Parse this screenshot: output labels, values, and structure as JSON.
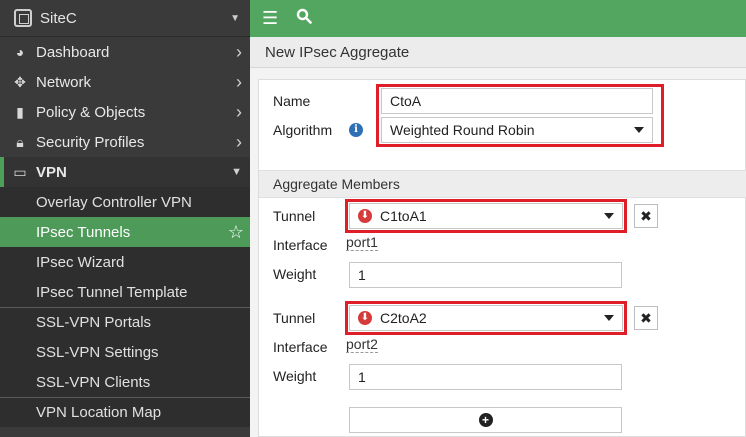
{
  "sidebar": {
    "site_name": "SiteC",
    "items": [
      {
        "label": "Dashboard",
        "icon": "dashboard-icon"
      },
      {
        "label": "Network",
        "icon": "network-icon"
      },
      {
        "label": "Policy & Objects",
        "icon": "policy-icon"
      },
      {
        "label": "Security Profiles",
        "icon": "lock-icon"
      }
    ],
    "vpn_label": "VPN",
    "vpn_subitems": [
      {
        "label": "Overlay Controller VPN"
      },
      {
        "label": "IPsec Tunnels"
      },
      {
        "label": "IPsec Wizard"
      },
      {
        "label": "IPsec Tunnel Template"
      },
      {
        "label": "SSL-VPN Portals"
      },
      {
        "label": "SSL-VPN Settings"
      },
      {
        "label": "SSL-VPN Clients"
      },
      {
        "label": "VPN Location Map"
      }
    ]
  },
  "page": {
    "title": "New IPsec Aggregate"
  },
  "form": {
    "name_label": "Name",
    "name_value": "CtoA",
    "algorithm_label": "Algorithm",
    "algorithm_value": "Weighted Round Robin",
    "members_header": "Aggregate Members",
    "members": [
      {
        "tunnel_label": "Tunnel",
        "tunnel_value": "C1toA1",
        "interface_label": "Interface",
        "interface_value": "port1",
        "weight_label": "Weight",
        "weight_value": "1"
      },
      {
        "tunnel_label": "Tunnel",
        "tunnel_value": "C2toA2",
        "interface_label": "Interface",
        "interface_value": "port2",
        "weight_label": "Weight",
        "weight_value": "1"
      }
    ]
  },
  "colors": {
    "accent": "#53a660",
    "highlight": "#e01e2a",
    "sidebar": "#3a3a3a"
  }
}
